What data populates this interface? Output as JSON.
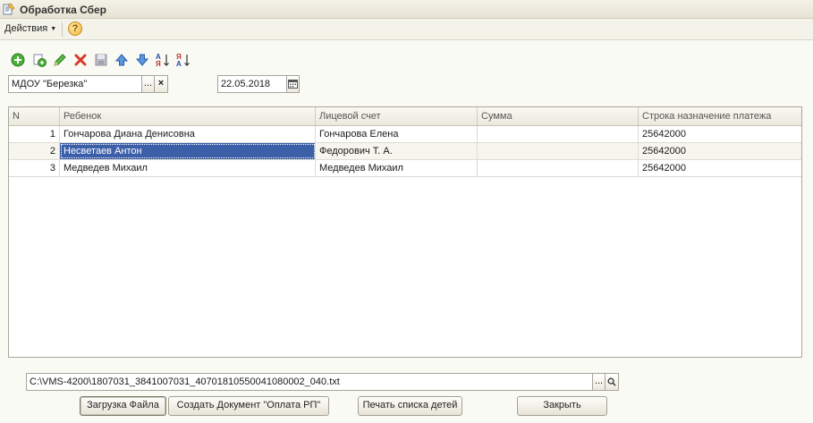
{
  "window": {
    "title": "Обработка  Сбер"
  },
  "menu": {
    "actions_label": "Действия",
    "help_label": "?"
  },
  "toolbar": {
    "icons": [
      "add-icon",
      "copy-icon",
      "edit-icon",
      "delete-icon",
      "save-icon",
      "move-up-icon",
      "move-down-icon",
      "sort-asc-icon",
      "sort-desc-icon"
    ]
  },
  "filters": {
    "organization": "МДОУ \"Березка\"",
    "select_button": "...",
    "clear_button": "×",
    "date": "22.05.2018"
  },
  "table": {
    "columns": [
      "N",
      "Ребенок",
      "Лицевой счет",
      "Сумма",
      "Строка назначение платежа"
    ],
    "rows": [
      {
        "n": "1",
        "child": "Гончарова Диана Денисовна",
        "account": "Гончарова Елена",
        "sum": "",
        "purpose": "25642000"
      },
      {
        "n": "2",
        "child": "Несветаев Антон",
        "account": "Федорович Т. А.",
        "sum": "",
        "purpose": "25642000"
      },
      {
        "n": "3",
        "child": "Медведев Михаил",
        "account": "Медведев Михаил",
        "sum": "",
        "purpose": "25642000"
      }
    ],
    "selected_row": 1
  },
  "file": {
    "path": "C:\\VMS-4200\\1807031_3841007031_40701810550041080002_040.txt",
    "select_button": "..."
  },
  "buttons": {
    "load": "Загрузка Файла",
    "create": "Создать Документ \"Оплата РП\"",
    "print": "Печать списка детей",
    "close": "Закрыть"
  },
  "colors": {
    "selection": "#3d5fa8",
    "accent_green": "#3aa03a",
    "accent_red": "#d93a2a",
    "accent_blue": "#3b7dd8"
  }
}
